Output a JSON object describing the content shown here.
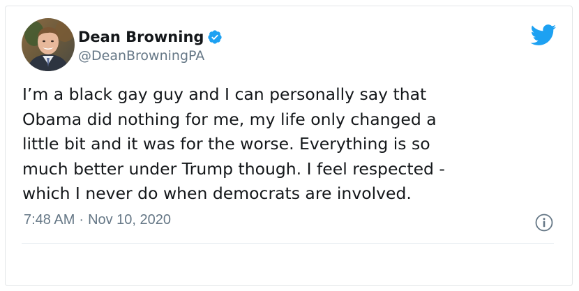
{
  "author": {
    "display_name": "Dean Browning",
    "handle": "@DeanBrowningPA",
    "verified": true
  },
  "tweet": {
    "text_lines": [
      "I’m a black gay guy and I can personally say that",
      "Obama did nothing for me, my life only changed a",
      "little bit and it was for the worse. Everything is so",
      "much better under Trump though. I feel respected -",
      "which I never do when democrats are involved."
    ],
    "time": "7:48 AM",
    "separator": "·",
    "date": "Nov 10, 2020"
  },
  "icons": {
    "verified": "verified-badge-icon",
    "brand": "twitter-bird-icon",
    "info": "info-icon"
  },
  "colors": {
    "twitter_blue": "#1da1f2",
    "text_primary": "#14171a",
    "text_secondary": "#657786"
  }
}
